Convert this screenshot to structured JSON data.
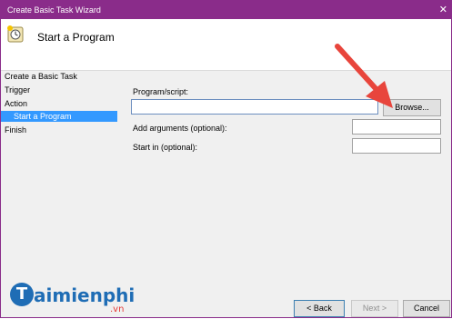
{
  "window": {
    "title": "Create Basic Task Wizard"
  },
  "header": {
    "title": "Start a Program",
    "icon": "scheduled-task-icon"
  },
  "nav": {
    "steps": [
      "Create a Basic Task",
      "Trigger",
      "Action",
      "Start a Program",
      "Finish"
    ],
    "selected_index": 3
  },
  "form": {
    "program_label": "Program/script:",
    "program_value": "",
    "args_label": "Add arguments (optional):",
    "args_value": "",
    "startin_label": "Start in (optional):",
    "startin_value": "",
    "browse_label": "Browse..."
  },
  "footer": {
    "back_label": "< Back",
    "next_label": "Next >",
    "cancel_label": "Cancel"
  },
  "watermark": {
    "word": "aimienphi",
    "suffix": ".vn",
    "badge": "T"
  },
  "colors": {
    "titlebar": "#8a2c8a",
    "selection": "#3399ff",
    "arrow": "#e8453c"
  }
}
